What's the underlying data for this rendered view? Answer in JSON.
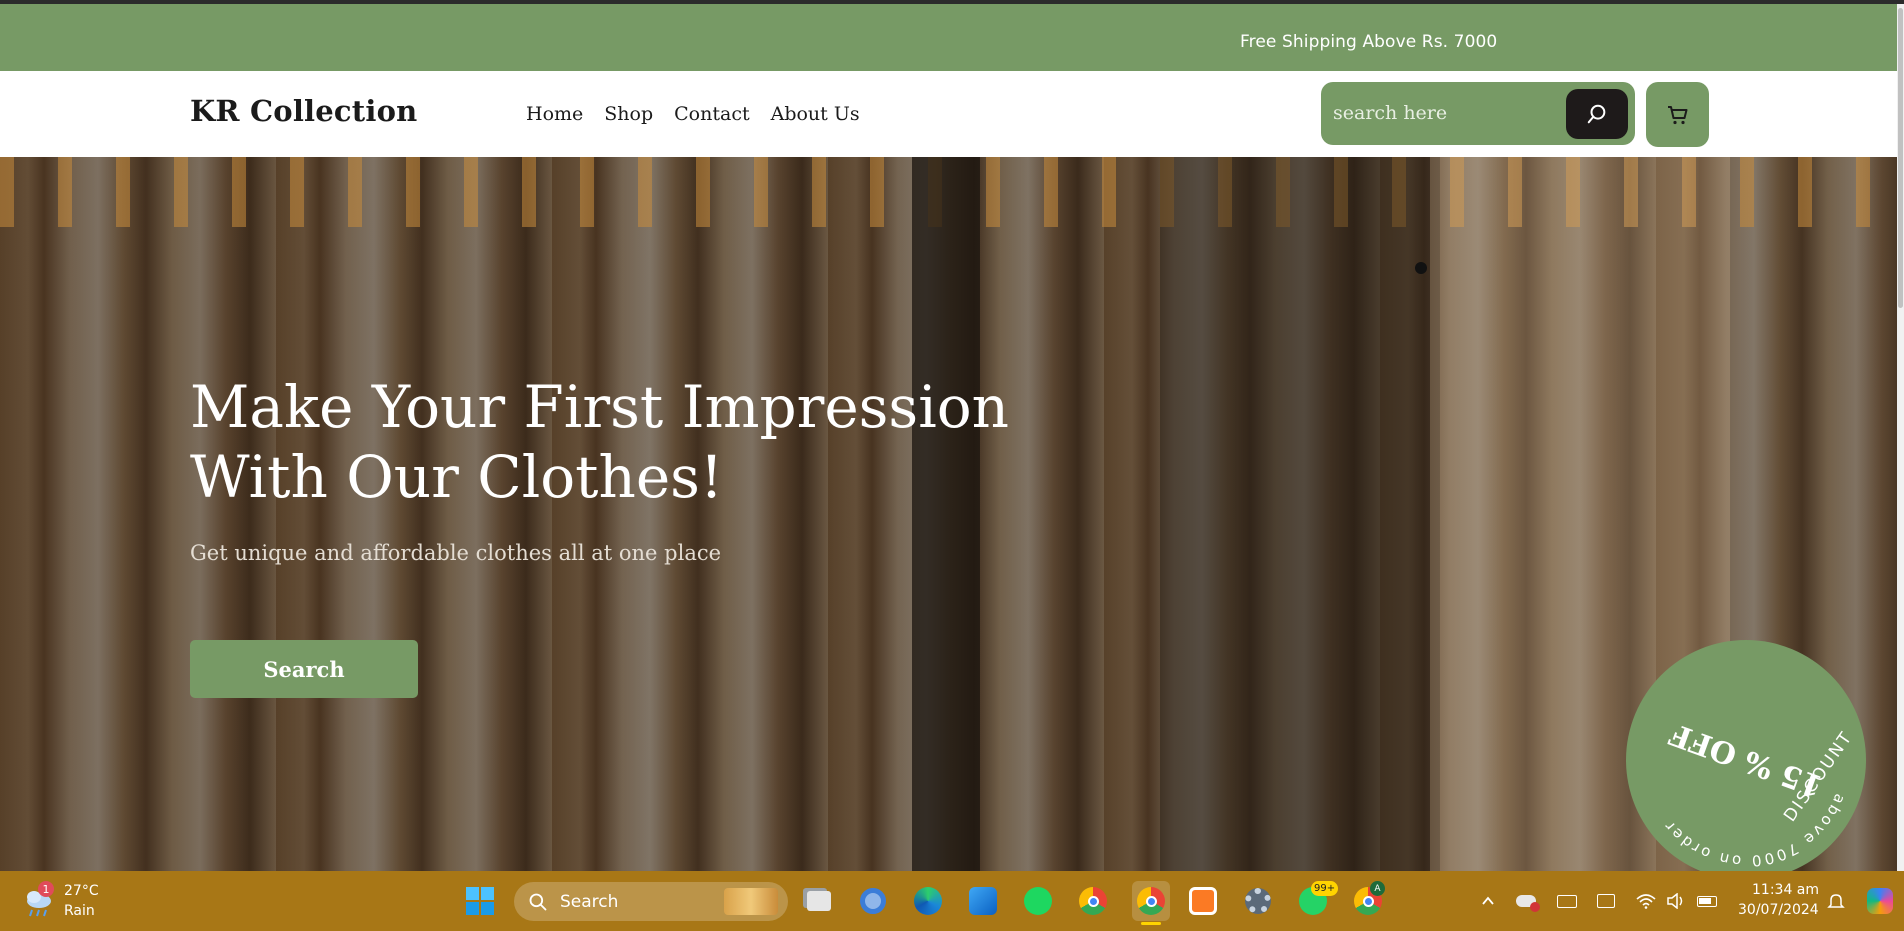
{
  "promo": {
    "text": "Free Shipping Above Rs. 7000"
  },
  "header": {
    "logo": "KR Collection",
    "menu": [
      "Home",
      "Shop",
      "Contact",
      "About Us"
    ],
    "search_placeholder": "search here"
  },
  "hero": {
    "title_line1": "Make Your First Impression",
    "title_line2": "With Our Clothes!",
    "subtitle": "Get unique and affordable clothes all at one place",
    "button_label": "Search"
  },
  "badge": {
    "main": "15 % OFF",
    "ring_text": "above 7000 on order",
    "side_text": "DISCOUNT",
    "color": "#779a65"
  },
  "taskbar": {
    "weather_temp": "27°C",
    "weather_desc": "Rain",
    "weather_badge": "1",
    "search_label": "Search",
    "whatsapp_badge": "99+",
    "chrome_profile": "A",
    "time": "11:34 am",
    "date": "30/07/2024",
    "icons": [
      "start-icon",
      "task-view-icon",
      "settings-icon",
      "edge-icon",
      "photos-icon",
      "spotify-icon",
      "chrome-icon",
      "chrome-icon",
      "xampp-icon",
      "gear-icon",
      "whatsapp-icon",
      "chrome-icon"
    ]
  },
  "colors": {
    "accent": "#779a65",
    "dark": "#1e1a1a",
    "taskbar": "#a87716"
  }
}
